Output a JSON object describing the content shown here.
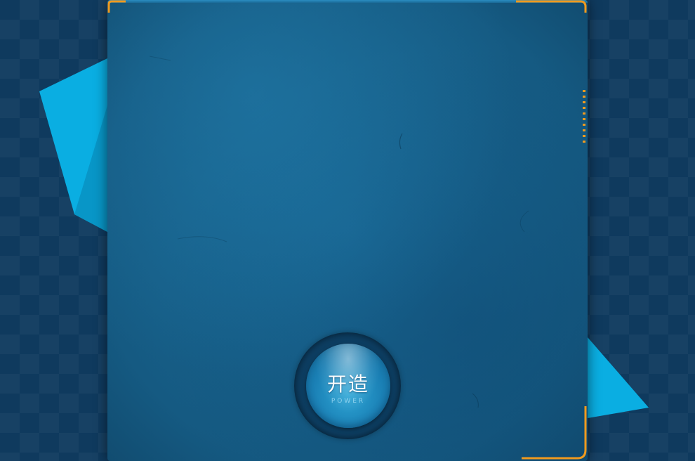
{
  "power_button": {
    "title": "开造",
    "subtitle": "POWER"
  },
  "colors": {
    "background": "#0f3a5e",
    "panel": "#1a6b98",
    "shard": "#0aaee2",
    "accent_orange": "#f09a1e"
  },
  "icons": {
    "shards": "decorative-shard-shapes",
    "corners": "orange-corner-bracket-icons"
  }
}
